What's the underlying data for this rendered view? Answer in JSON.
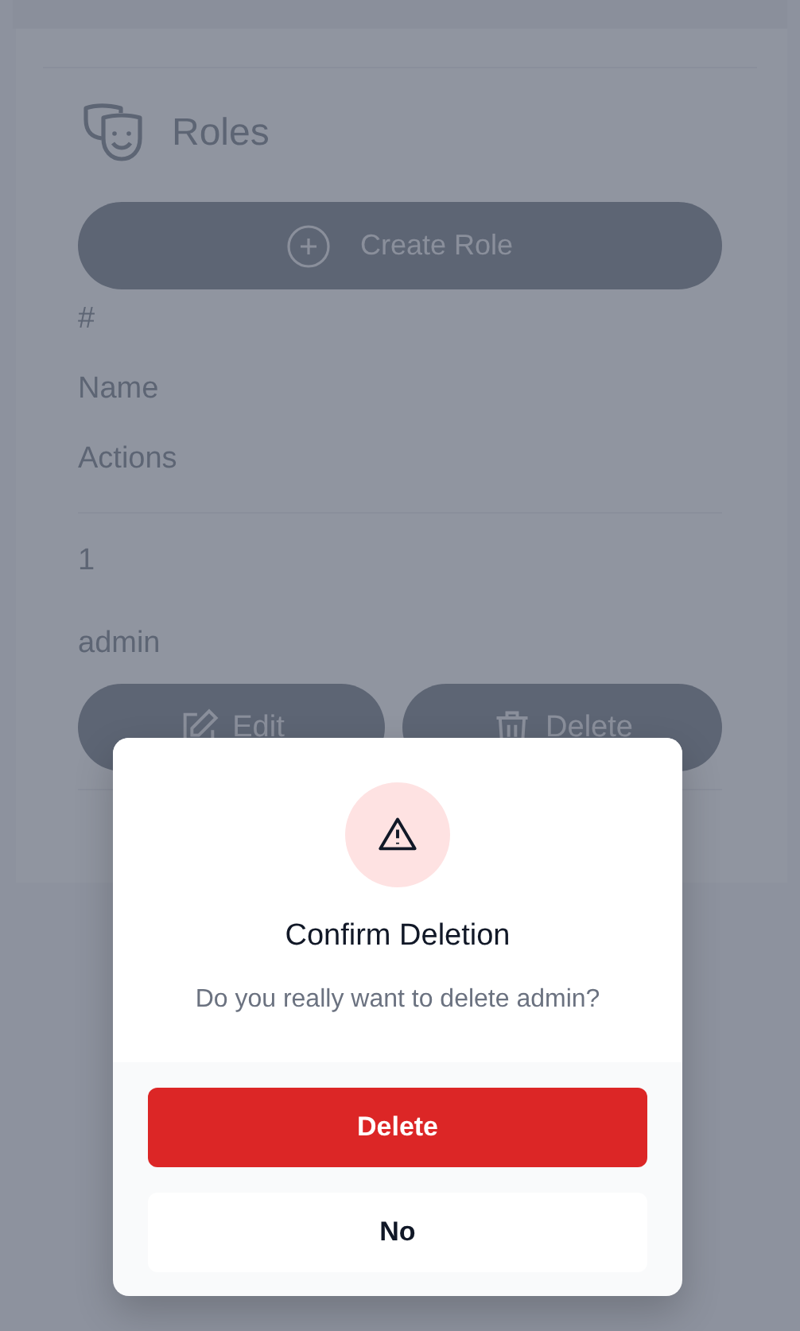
{
  "page": {
    "title": "Roles",
    "create_button": "Create Role"
  },
  "table": {
    "columns": [
      "#",
      "Name",
      "Actions"
    ],
    "rows": [
      {
        "cells": [
          "1",
          "admin"
        ],
        "actions": [
          {
            "kind": "edit",
            "label": "Edit"
          },
          {
            "kind": "delete",
            "label": "Delete"
          }
        ]
      }
    ]
  },
  "dialog": {
    "title": "Confirm Deletion",
    "message": "Do you really want to delete admin?",
    "buttons": [
      {
        "kind": "danger",
        "label": "Delete"
      },
      {
        "kind": "plain",
        "label": "No"
      }
    ]
  }
}
